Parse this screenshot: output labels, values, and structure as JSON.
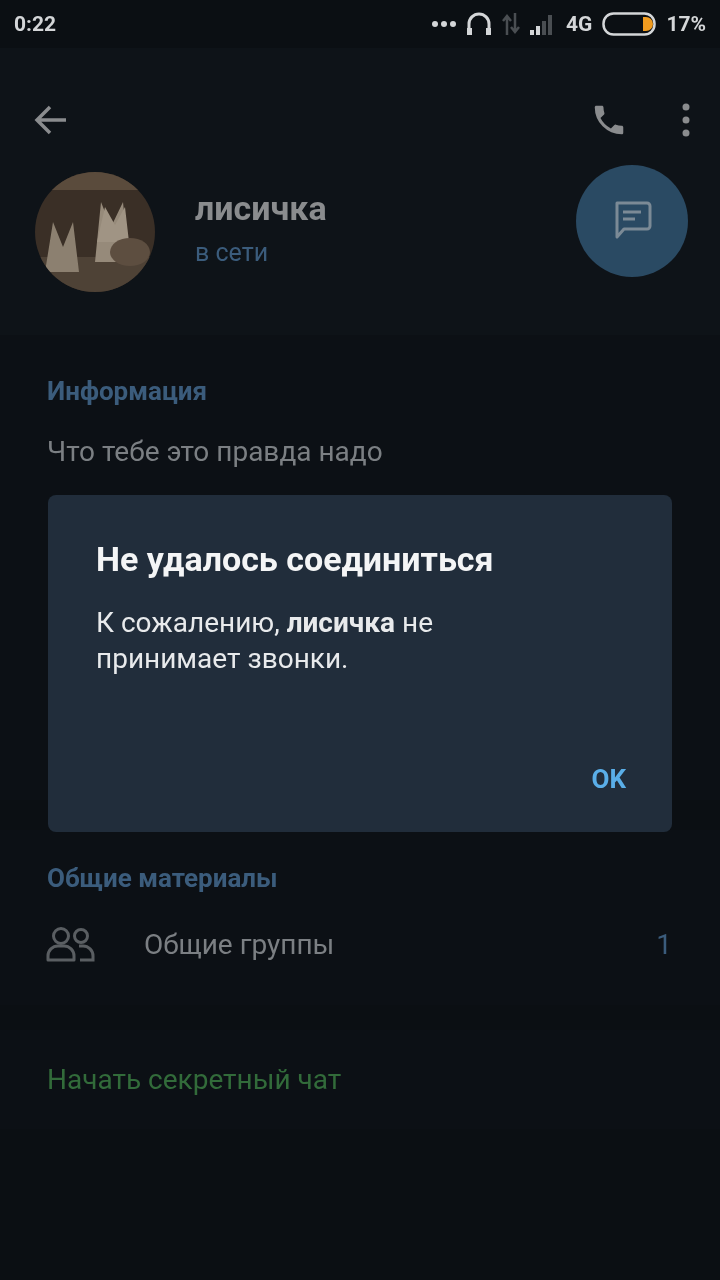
{
  "status_bar": {
    "time": "0:22",
    "network": "4G",
    "battery": "17%"
  },
  "profile": {
    "name": "лисичка",
    "status": "в сети"
  },
  "info": {
    "header": "Информация",
    "bio": "Что тебе это правда надо"
  },
  "shared": {
    "header": "Общие материалы",
    "items": [
      {
        "label": "Общие группы",
        "count": "1"
      }
    ]
  },
  "secret_chat": "Начать секретный чат",
  "dialog": {
    "title": "Не удалось соединиться",
    "message": "К сожалению, **лисичка** не принимает звонки.",
    "button": "OK"
  }
}
